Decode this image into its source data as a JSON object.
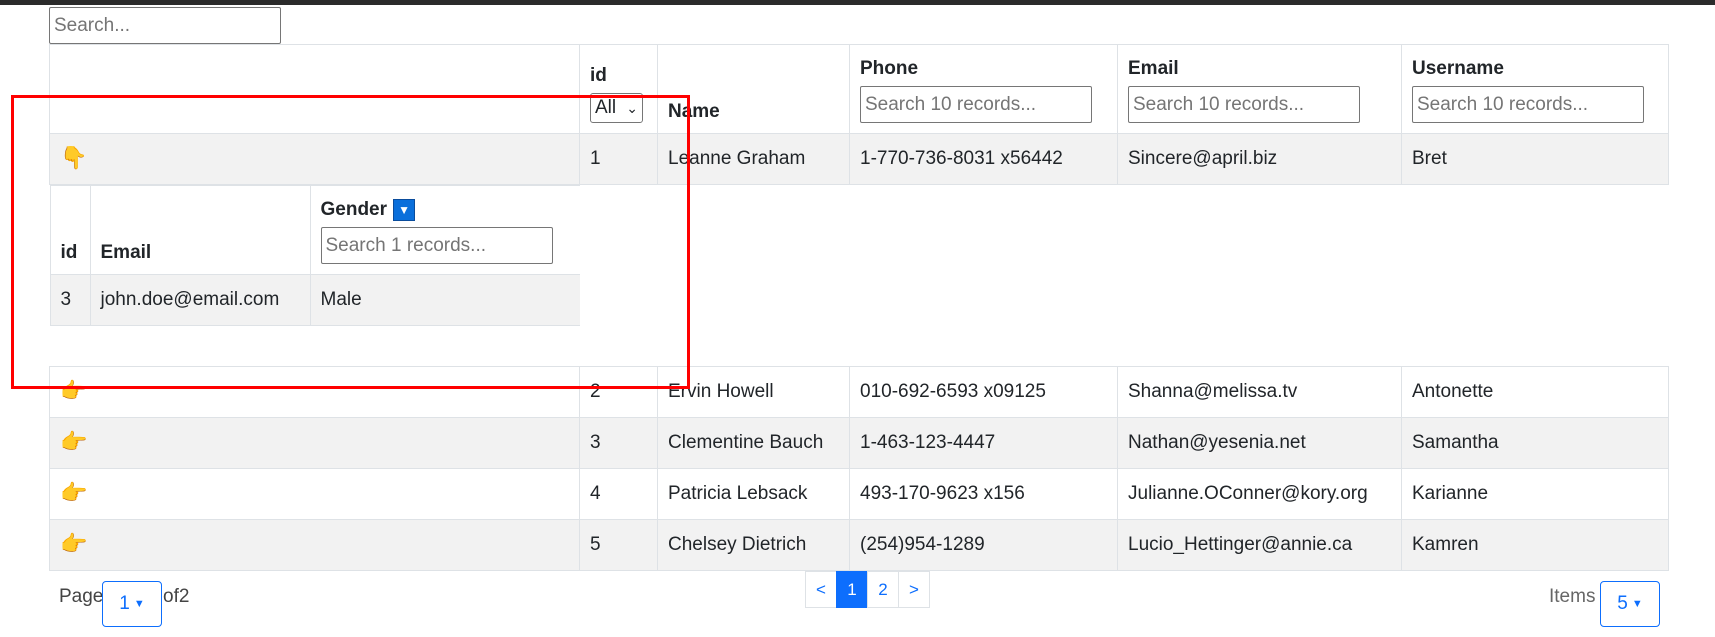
{
  "search": {
    "placeholder": "Search..."
  },
  "table": {
    "headers": {
      "id": "id",
      "id_filter_value": "All",
      "name": "Name",
      "phone": "Phone",
      "email": "Email",
      "username": "Username",
      "filter_placeholder": "Search 10 records..."
    },
    "rows": [
      {
        "id": "1",
        "name": "Leanne Graham",
        "phone": "1-770-736-8031 x56442",
        "email": "Sincere@april.biz",
        "username": "Bret"
      },
      {
        "id": "2",
        "name": "Ervin Howell",
        "phone": "010-692-6593 x09125",
        "email": "Shanna@melissa.tv",
        "username": "Antonette"
      },
      {
        "id": "3",
        "name": "Clementine Bauch",
        "phone": "1-463-123-4447",
        "email": "Nathan@yesenia.net",
        "username": "Samantha"
      },
      {
        "id": "4",
        "name": "Patricia Lebsack",
        "phone": "493-170-9623 x156",
        "email": "Julianne.OConner@kory.org",
        "username": "Karianne"
      },
      {
        "id": "5",
        "name": "Chelsey Dietrich",
        "phone": "(254)954-1289",
        "email": "Lucio_Hettinger@annie.ca",
        "username": "Kamren"
      }
    ],
    "expand_icon_expanded": "👇",
    "expand_icon_collapsed": "👉"
  },
  "subtable": {
    "headers": {
      "id": "id",
      "email": "Email",
      "gender": "Gender",
      "sort_glyph": "▼",
      "filter_placeholder": "Search 1 records..."
    },
    "rows": [
      {
        "id": "3",
        "email": "john.doe@email.com",
        "gender": "Male"
      }
    ]
  },
  "footer": {
    "page_label": "Page",
    "page_value": "1",
    "of_label": "of2",
    "pagination": {
      "prev": "<",
      "pages": [
        "1",
        "2"
      ],
      "next": ">"
    },
    "items_label": "Items",
    "items_value": "5"
  },
  "colors": {
    "accent": "#0d6efd",
    "highlight": "#ff0000",
    "stripe": "#f2f2f2"
  }
}
